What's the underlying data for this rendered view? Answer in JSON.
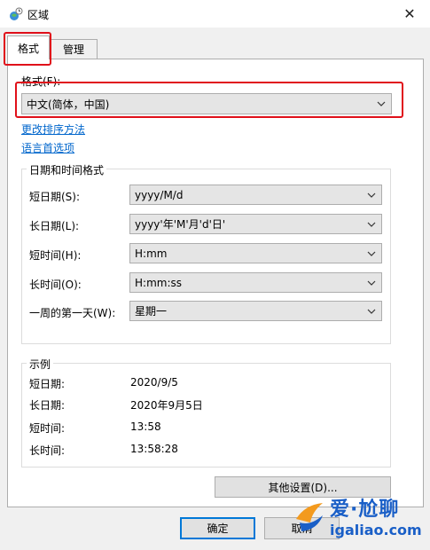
{
  "window": {
    "title": "区域",
    "close_glyph": "✕"
  },
  "tabs": [
    {
      "label": "格式",
      "active": true
    },
    {
      "label": "管理",
      "active": false
    }
  ],
  "format": {
    "label": "格式(F):",
    "selected": "中文(简体，中国)"
  },
  "links": {
    "sort": "更改排序方法",
    "language": "语言首选项"
  },
  "datetime": {
    "title": "日期和时间格式",
    "rows": [
      {
        "label": "短日期(S):",
        "value": "yyyy/M/d"
      },
      {
        "label": "长日期(L):",
        "value": "yyyy'年'M'月'd'日'"
      },
      {
        "label": "短时间(H):",
        "value": "H:mm"
      },
      {
        "label": "长时间(O):",
        "value": "H:mm:ss"
      },
      {
        "label": "一周的第一天(W):",
        "value": "星期一"
      }
    ]
  },
  "examples": {
    "title": "示例",
    "rows": [
      {
        "label": "短日期:",
        "value": "2020/9/5"
      },
      {
        "label": "长日期:",
        "value": "2020年9月5日"
      },
      {
        "label": "短时间:",
        "value": "13:58"
      },
      {
        "label": "长时间:",
        "value": "13:58:28"
      }
    ]
  },
  "buttons": {
    "other_settings": "其他设置(D)...",
    "ok": "确定",
    "cancel": "取消"
  },
  "watermark": {
    "text": "爱·尬聊",
    "url": "igaliao.com"
  },
  "colors": {
    "highlight": "#e0101a",
    "link": "#0066cc",
    "default_button_border": "#0078d7"
  }
}
